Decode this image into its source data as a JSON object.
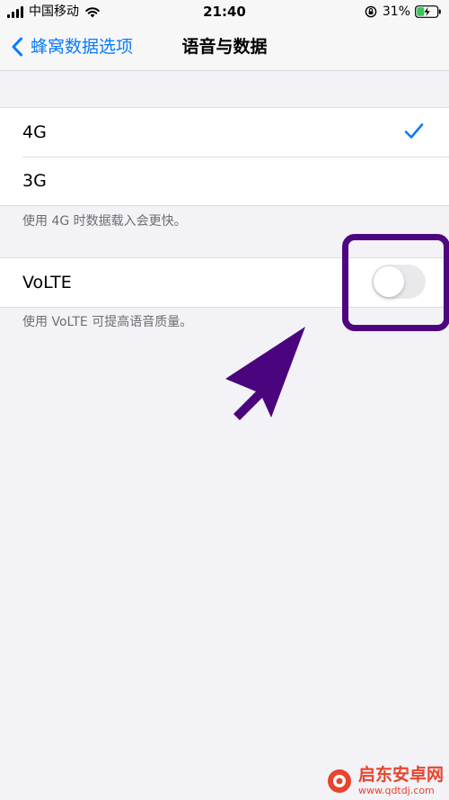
{
  "status_bar": {
    "carrier": "中国移动",
    "time": "21:40",
    "battery_percent": "31%",
    "icons": [
      "signal-icon",
      "wifi-icon",
      "orientation-lock-icon",
      "battery-charging-icon"
    ]
  },
  "nav": {
    "back_label": "蜂窝数据选项",
    "title": "语音与数据",
    "back_icon": "chevron-left-icon"
  },
  "network_options": [
    {
      "label": "4G",
      "selected": true
    },
    {
      "label": "3G",
      "selected": false
    }
  ],
  "network_footer": "使用 4G 时数据载入会更快。",
  "volte": {
    "label": "VoLTE",
    "enabled": false,
    "footer": "使用 VoLTE 可提高语音质量。"
  },
  "annotation": {
    "highlight_color": "#4E067E",
    "arrow_color": "#4A057E"
  },
  "colors": {
    "accent": "#0A7AFF",
    "background": "#F2F2F7",
    "toggle_off": "#E9E9EB"
  },
  "watermark": {
    "brand": "启东安卓网",
    "url": "www.qdtdj.com"
  }
}
